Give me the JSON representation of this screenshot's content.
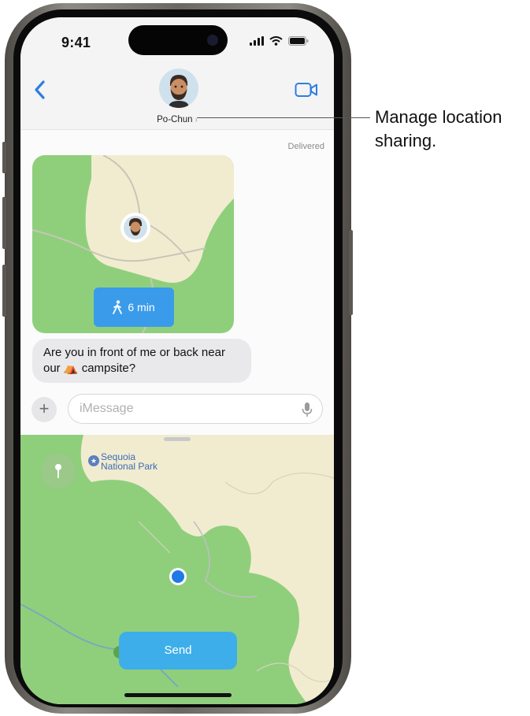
{
  "status_bar": {
    "time": "9:41"
  },
  "header": {
    "contact_name": "Po-Chun"
  },
  "messages": {
    "delivered": "Delivered",
    "walk_time": "6 min",
    "bubble_text": "Are you in front of me or back near our ⛺ campsite?"
  },
  "input": {
    "placeholder": "iMessage",
    "plus": "+"
  },
  "map": {
    "park_label": "Sequoia National Park"
  },
  "send_label": "Send",
  "callout": "Manage location sharing.",
  "colors": {
    "accent": "#2f7de1",
    "send": "#3daee9",
    "map_green": "#8fcf7c",
    "map_sand": "#f1ecd0"
  },
  "icons": [
    "back-chevron-icon",
    "video-call-icon",
    "walking-icon",
    "microphone-icon",
    "map-pin-icon",
    "park-icon",
    "location-dot-icon"
  ]
}
